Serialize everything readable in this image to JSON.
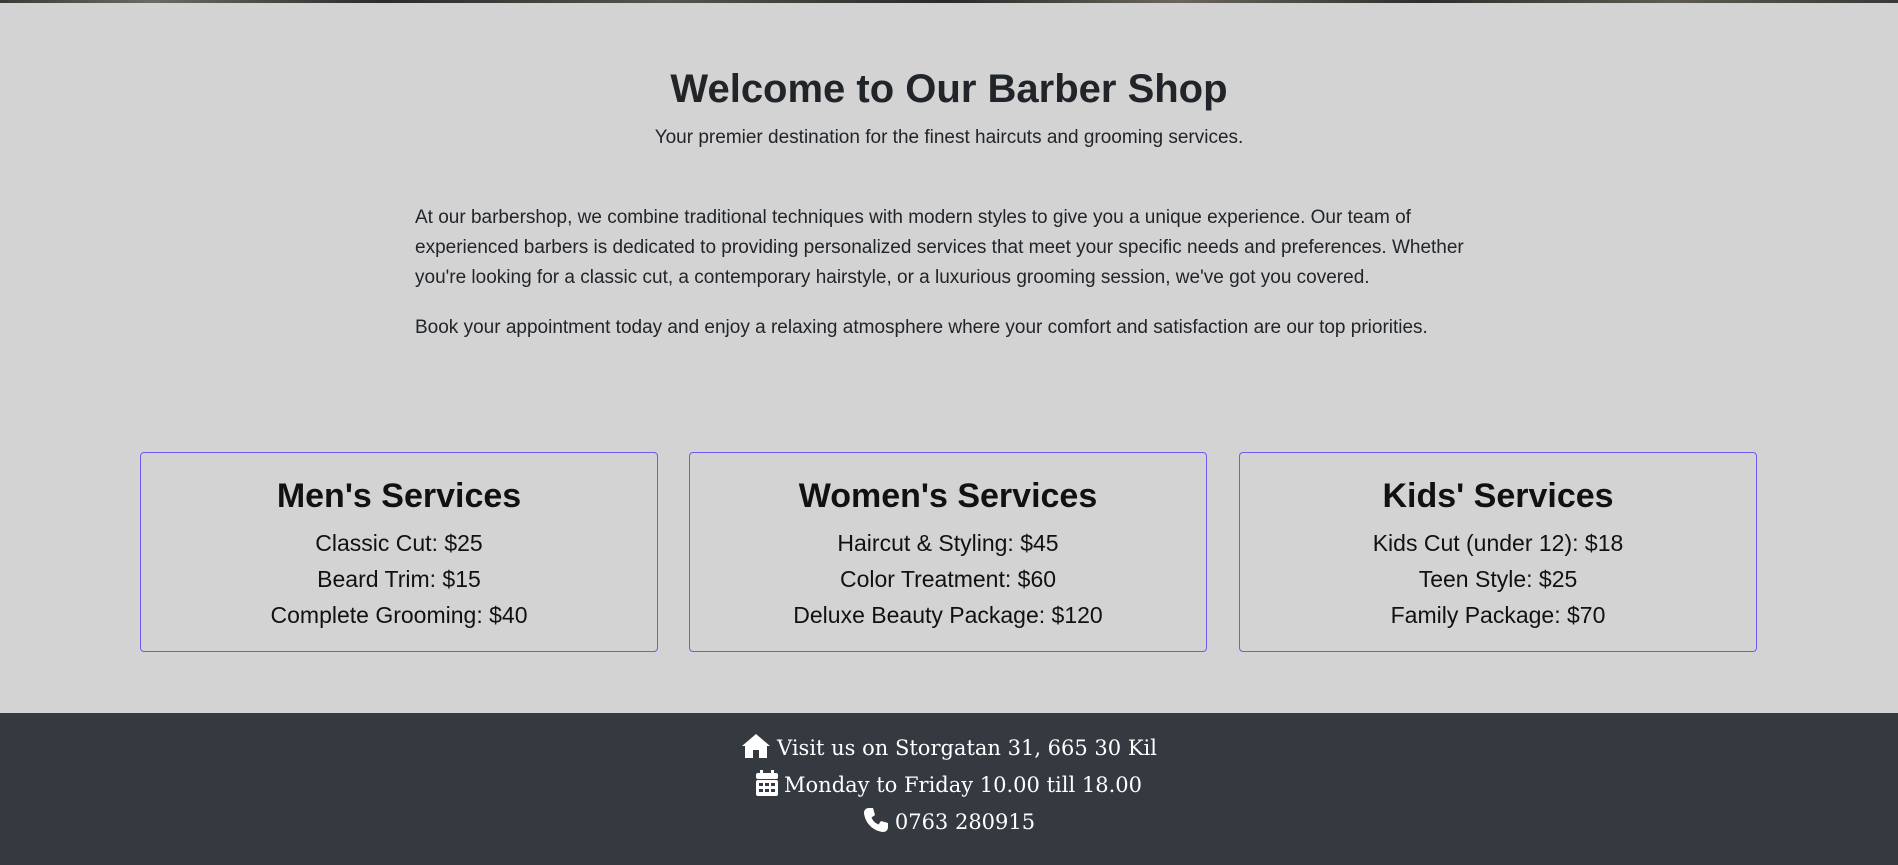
{
  "header": {
    "title": "Welcome to Our Barber Shop",
    "subtitle": "Your premier destination for the finest haircuts and grooming services."
  },
  "about": {
    "paragraph1": "At our barbershop, we combine traditional techniques with modern styles to give you a unique experience. Our team of experienced barbers is dedicated to providing personalized services that meet your specific needs and preferences. Whether you're looking for a classic cut, a contemporary hairstyle, or a luxurious grooming session, we've got you covered.",
    "paragraph2": "Book your appointment today and enjoy a relaxing atmosphere where your comfort and satisfaction are our top priorities."
  },
  "services": [
    {
      "title": "Men's Services",
      "items": [
        "Classic Cut: $25",
        "Beard Trim: $15",
        "Complete Grooming: $40"
      ]
    },
    {
      "title": "Women's Services",
      "items": [
        "Haircut & Styling: $45",
        "Color Treatment: $60",
        "Deluxe Beauty Package: $120"
      ]
    },
    {
      "title": "Kids' Services",
      "items": [
        "Kids Cut (under 12): $18",
        "Teen Style: $25",
        "Family Package: $70"
      ]
    }
  ],
  "footer": {
    "address": "Visit us on Storgatan 31, 665 30 Kil",
    "hours": "Monday to Friday 10.00 till 18.00",
    "phone": "0763 280915",
    "icons": [
      "home-icon",
      "calendar-icon",
      "phone-icon"
    ]
  },
  "colors": {
    "background": "#d3d3d3",
    "card_border": "#6f5bf0",
    "footer_bg": "#343a40"
  }
}
